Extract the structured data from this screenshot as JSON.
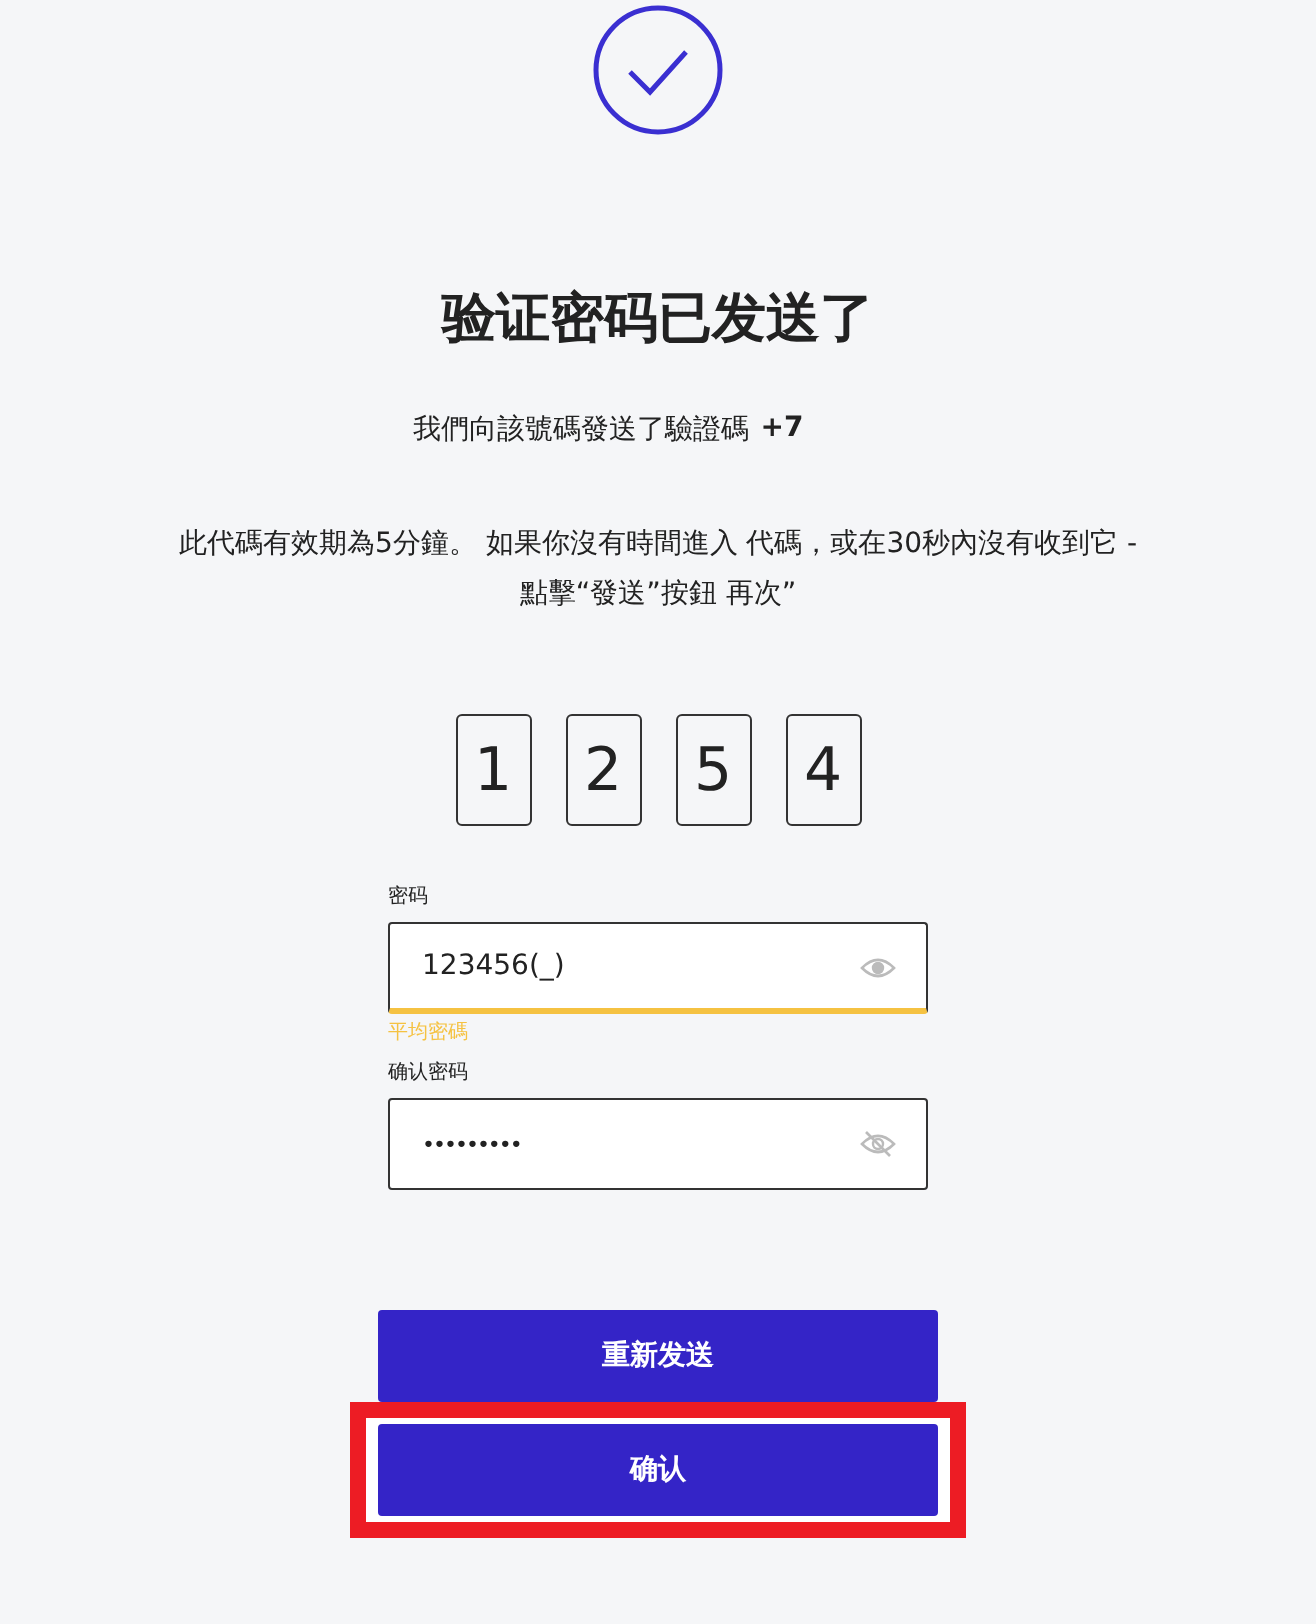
{
  "title": "验证密码已发送了",
  "sent_line": {
    "text": "我們向該號碼發送了驗證碼",
    "phone": "+7"
  },
  "info": [
    "此代碼有效期為5分鐘。 如果你沒有時間進入 代碼，或在30秒內沒有收到它 -",
    "點擊“發送”按鈕 再次”"
  ],
  "code_digits": [
    "1",
    "2",
    "5",
    "4"
  ],
  "fields": [
    {
      "label": "密码",
      "value": "123456(_)",
      "masked": false,
      "strength": "平均密碼",
      "color": "#f5c242"
    },
    {
      "label": "确认密码",
      "value": "•••••••••",
      "masked": true
    }
  ],
  "buttons": [
    {
      "label": "重新发送",
      "highlighted": false
    },
    {
      "label": "确认",
      "highlighted": true
    }
  ]
}
